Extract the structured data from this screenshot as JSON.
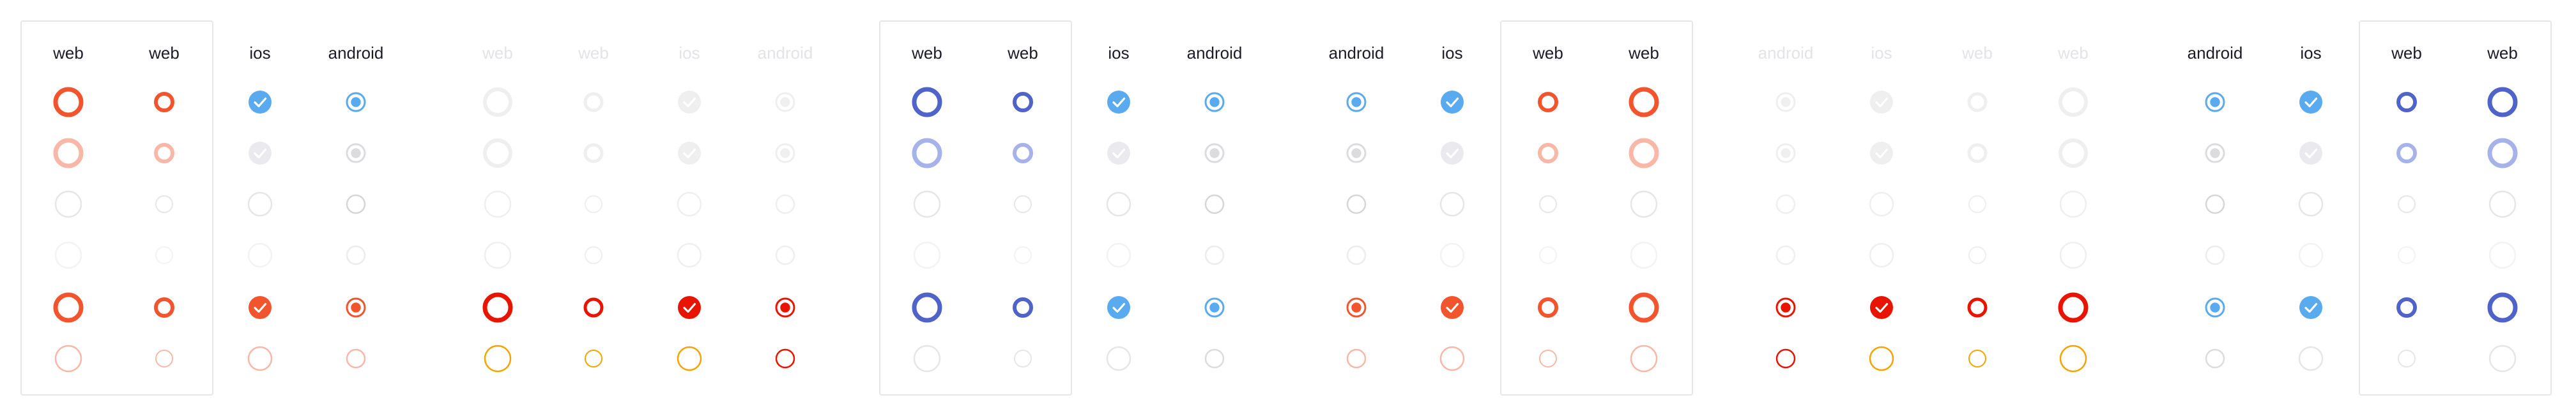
{
  "colors": {
    "blue": "#4f63c9",
    "blue_light": "#a6b3ea",
    "ios_blue": "#5aaaf0",
    "ios_blue_light": "#a9d2f7",
    "android_blue": "#5aaaf0",
    "orange": "#f2542d",
    "orange_light": "#f8b7a7",
    "red": "#e81400",
    "amber": "#f5a300",
    "disabled": "#e6e6ea",
    "disabled_faint": "#efefef"
  },
  "panels": [
    {
      "columns": [
        {
          "label": "web",
          "faded": false,
          "kind": "web-lg"
        },
        {
          "label": "web",
          "faded": false,
          "kind": "web-sm"
        },
        {
          "label": "ios",
          "faded": false,
          "kind": "ios"
        },
        {
          "label": "android",
          "faded": false,
          "kind": "android"
        }
      ],
      "theme": "orange",
      "dim": false
    },
    {
      "columns": [
        {
          "label": "web",
          "faded": true,
          "kind": "web-lg"
        },
        {
          "label": "web",
          "faded": true,
          "kind": "web-sm"
        },
        {
          "label": "ios",
          "faded": true,
          "kind": "ios"
        },
        {
          "label": "android",
          "faded": true,
          "kind": "android"
        }
      ],
      "theme": "red",
      "dim": true
    },
    {
      "columns": [
        {
          "label": "web",
          "faded": false,
          "kind": "web-lg"
        },
        {
          "label": "web",
          "faded": false,
          "kind": "web-sm"
        },
        {
          "label": "ios",
          "faded": false,
          "kind": "ios"
        },
        {
          "label": "android",
          "faded": false,
          "kind": "android"
        }
      ],
      "theme": "blue",
      "dim": false
    },
    {
      "columns": [
        {
          "label": "android",
          "faded": false,
          "kind": "android"
        },
        {
          "label": "ios",
          "faded": false,
          "kind": "ios"
        },
        {
          "label": "web",
          "faded": false,
          "kind": "web-sm"
        },
        {
          "label": "web",
          "faded": false,
          "kind": "web-lg"
        }
      ],
      "theme": "orange",
      "dim": false
    },
    {
      "columns": [
        {
          "label": "android",
          "faded": true,
          "kind": "android"
        },
        {
          "label": "ios",
          "faded": true,
          "kind": "ios"
        },
        {
          "label": "web",
          "faded": true,
          "kind": "web-sm"
        },
        {
          "label": "web",
          "faded": true,
          "kind": "web-lg"
        }
      ],
      "theme": "red",
      "dim": true
    },
    {
      "columns": [
        {
          "label": "android",
          "faded": false,
          "kind": "android"
        },
        {
          "label": "ios",
          "faded": false,
          "kind": "ios"
        },
        {
          "label": "web",
          "faded": false,
          "kind": "web-sm"
        },
        {
          "label": "web",
          "faded": false,
          "kind": "web-lg"
        }
      ],
      "theme": "blue",
      "dim": false
    }
  ]
}
